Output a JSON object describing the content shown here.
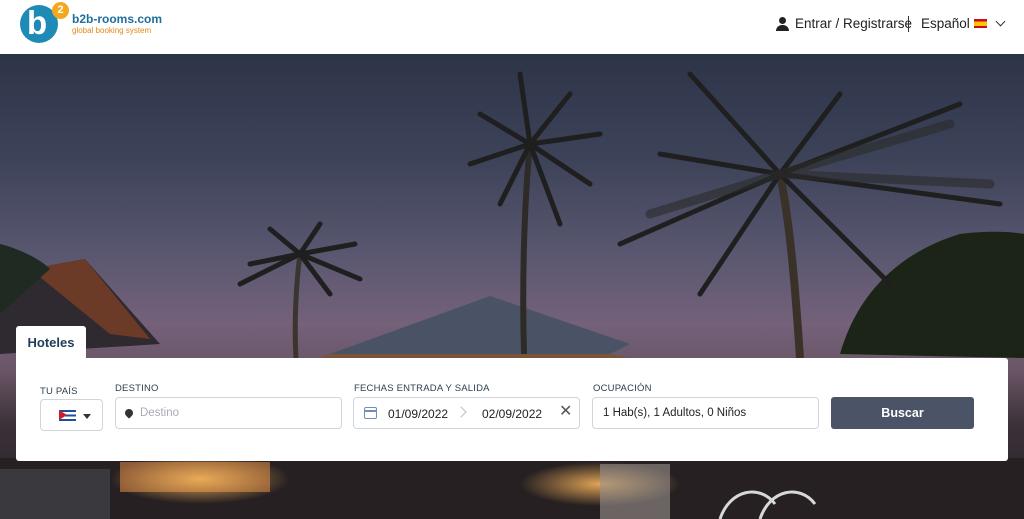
{
  "header": {
    "logo_badge": "2",
    "brand_name": "b2b-rooms.com",
    "brand_tagline": "global booking system",
    "login_label": "Entrar / Registrarse",
    "language_label": "Español",
    "language_icon": "flag-es-icon"
  },
  "search": {
    "tab_label": "Hoteles",
    "country": {
      "label": "TU PAÍS",
      "flag_icon": "flag-cu-icon"
    },
    "destination": {
      "label": "DESTINO",
      "placeholder": "Destino",
      "value": ""
    },
    "dates": {
      "label": "FECHAS ENTRADA Y SALIDA",
      "check_in": "01/09/2022",
      "check_out": "02/09/2022",
      "clear_symbol": "✕"
    },
    "occupancy": {
      "label": "OCUPACIÓN",
      "value": "1 Hab(s), 1 Adultos, 0 Niños"
    },
    "submit_label": "Buscar"
  },
  "colors": {
    "brand_blue": "#1e8ab6",
    "brand_orange": "#f4a81d",
    "button": "#4b5366"
  }
}
